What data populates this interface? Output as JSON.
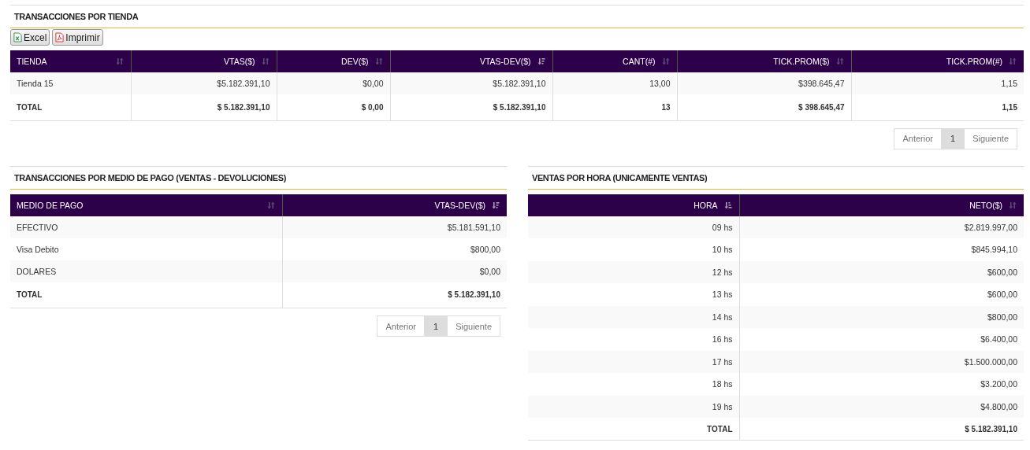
{
  "sections": [
    {
      "title": "TRANSACCIONES POR TIENDA",
      "export_buttons": [
        {
          "label": "Excel",
          "kind": "excel"
        },
        {
          "label": "Imprimir",
          "kind": "pdf"
        }
      ],
      "table": {
        "columns": [
          {
            "label": "TIENDA",
            "kind": "unsorted",
            "numeric": false
          },
          {
            "label": "VTAS($)",
            "kind": "unsorted",
            "numeric": true
          },
          {
            "label": "DEV($)",
            "kind": "unsorted",
            "numeric": true
          },
          {
            "label": "VTAS-DEV($)",
            "kind": "descending",
            "numeric": true
          },
          {
            "label": "CANT(#)",
            "kind": "unsorted",
            "numeric": true
          },
          {
            "label": "TICK.PROM($)",
            "kind": "unsorted",
            "numeric": true
          },
          {
            "label": "TICK.PROM(#)",
            "kind": "unsorted",
            "numeric": true
          }
        ],
        "rows": [
          {
            "kind": "data",
            "cells": [
              "Tienda 15",
              "$5.182.391,10",
              "$0,00",
              "$5.182.391,10",
              "13,00",
              "$398.645,47",
              "1,15"
            ]
          },
          {
            "kind": "total",
            "cells": [
              "TOTAL",
              "$ 5.182.391,10",
              "$ 0,00",
              "$ 5.182.391,10",
              "13",
              "$ 398.645,47",
              "1,15"
            ]
          }
        ]
      },
      "pagination": {
        "previous": "Anterior",
        "pages": [
          {
            "label": "1",
            "selected": true
          }
        ],
        "next": "Siguiente"
      }
    },
    {
      "title": "TRANSACCIONES POR MEDIO DE PAGO (VENTAS - DEVOLUCIONES)",
      "table": {
        "columns": [
          {
            "label": "MEDIO DE PAGO",
            "kind": "unsorted",
            "numeric": false
          },
          {
            "label": "VTAS-DEV($)",
            "kind": "descending",
            "numeric": true
          }
        ],
        "rows": [
          {
            "kind": "data",
            "cells": [
              "EFECTIVO",
              "$5.181.591,10"
            ]
          },
          {
            "kind": "data",
            "cells": [
              "Visa Debito",
              "$800,00"
            ]
          },
          {
            "kind": "data",
            "cells": [
              "DOLARES",
              "$0,00"
            ]
          },
          {
            "kind": "total",
            "cells": [
              "TOTAL",
              "$ 5.182.391,10"
            ]
          }
        ]
      },
      "pagination": {
        "previous": "Anterior",
        "pages": [
          {
            "label": "1",
            "selected": true
          }
        ],
        "next": "Siguiente"
      }
    },
    {
      "title": "VENTAS POR HORA (UNICAMENTE VENTAS)",
      "table": {
        "columns": [
          {
            "label": "HORA",
            "kind": "ascending",
            "numeric": true
          },
          {
            "label": "NETO($)",
            "kind": "unsorted",
            "numeric": true
          }
        ],
        "rows": [
          {
            "kind": "data",
            "cells": [
              "09 hs",
              "$2.819.997,00"
            ]
          },
          {
            "kind": "data",
            "cells": [
              "10 hs",
              "$845.994,10"
            ]
          },
          {
            "kind": "data",
            "cells": [
              "12 hs",
              "$600,00"
            ]
          },
          {
            "kind": "data",
            "cells": [
              "13 hs",
              "$600,00"
            ]
          },
          {
            "kind": "data",
            "cells": [
              "14 hs",
              "$800,00"
            ]
          },
          {
            "kind": "data",
            "cells": [
              "16 hs",
              "$6.400,00"
            ]
          },
          {
            "kind": "data",
            "cells": [
              "17 hs",
              "$1.500.000,00"
            ]
          },
          {
            "kind": "data",
            "cells": [
              "18 hs",
              "$3.200,00"
            ]
          },
          {
            "kind": "data",
            "cells": [
              "19 hs",
              "$4.800,00"
            ]
          },
          {
            "kind": "total",
            "cells": [
              "TOTAL",
              "$ 5.182.391,10"
            ]
          }
        ]
      }
    }
  ]
}
